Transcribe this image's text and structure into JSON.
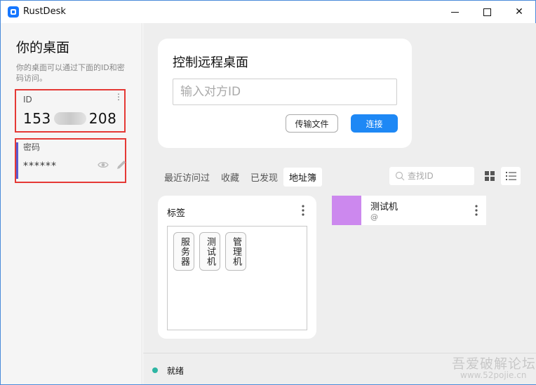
{
  "titlebar": {
    "title": "RustDesk",
    "icon": "rustdesk-logo-icon",
    "minimize_icon": "minimize-icon",
    "maximize_icon": "maximize-icon",
    "close_icon": "close-icon",
    "close_glyph": "✕"
  },
  "left_panel": {
    "title": "你的桌面",
    "description": "你的桌面可以通过下面的ID和密码访问。",
    "id_label": "ID",
    "id_prefix": "153",
    "id_suffix": "208",
    "id_menu_glyph": "⋮",
    "password_label": "密码",
    "password_value": "******",
    "eye_icon": "eye-icon",
    "edit_icon": "pencil-icon"
  },
  "connect": {
    "title": "控制远程桌面",
    "input_placeholder": "输入对方ID",
    "transfer_button": "传输文件",
    "connect_button": "连接"
  },
  "tabs": [
    {
      "label": "最近访问过",
      "active": false
    },
    {
      "label": "收藏",
      "active": false
    },
    {
      "label": "已发现",
      "active": false
    },
    {
      "label": "地址簿",
      "active": true
    }
  ],
  "search": {
    "placeholder": "查找ID"
  },
  "tags": {
    "title": "标签",
    "items": [
      "服务器",
      "测试机",
      "管理机"
    ]
  },
  "peer": {
    "name": "测试机",
    "sub": "@",
    "avatar_color": "#cc88ee"
  },
  "status": {
    "text": "就绪",
    "dot_color": "#2db5a3"
  },
  "watermark": {
    "title": "吾爱破解论坛",
    "url": "www.52pojie.cn"
  },
  "colors": {
    "accent": "#1e88f5",
    "highlight_border": "#e53935"
  }
}
